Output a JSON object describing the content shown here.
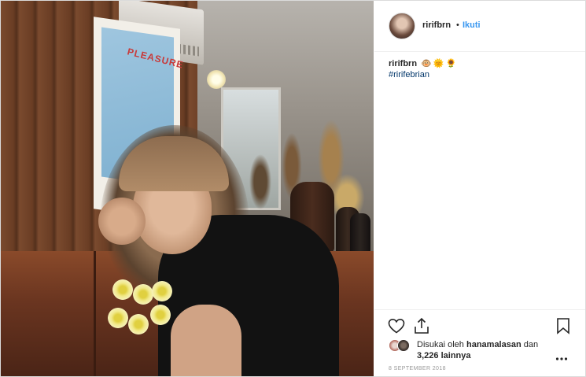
{
  "post": {
    "username": "ririfbrn",
    "separator": "•",
    "follow_label": "Ikuti",
    "caption": {
      "username": "ririfbrn",
      "emojis": [
        "🐵",
        "🌞",
        "🌻"
      ],
      "hashtag": "#ririfebrian"
    },
    "likes": {
      "prefix": "Disukai oleh",
      "user": "hanamalasan",
      "connector": "dan",
      "others": "3,226 lainnya"
    },
    "date": "8 SEPTEMBER 2018",
    "photo_text": "PLEASURE"
  },
  "icons": {
    "like": "heart-icon",
    "share": "share-icon",
    "save": "bookmark-icon",
    "more": "more-options-icon"
  },
  "colors": {
    "link": "#3897f0",
    "hashtag": "#003569",
    "text": "#262626",
    "muted": "#999999"
  }
}
